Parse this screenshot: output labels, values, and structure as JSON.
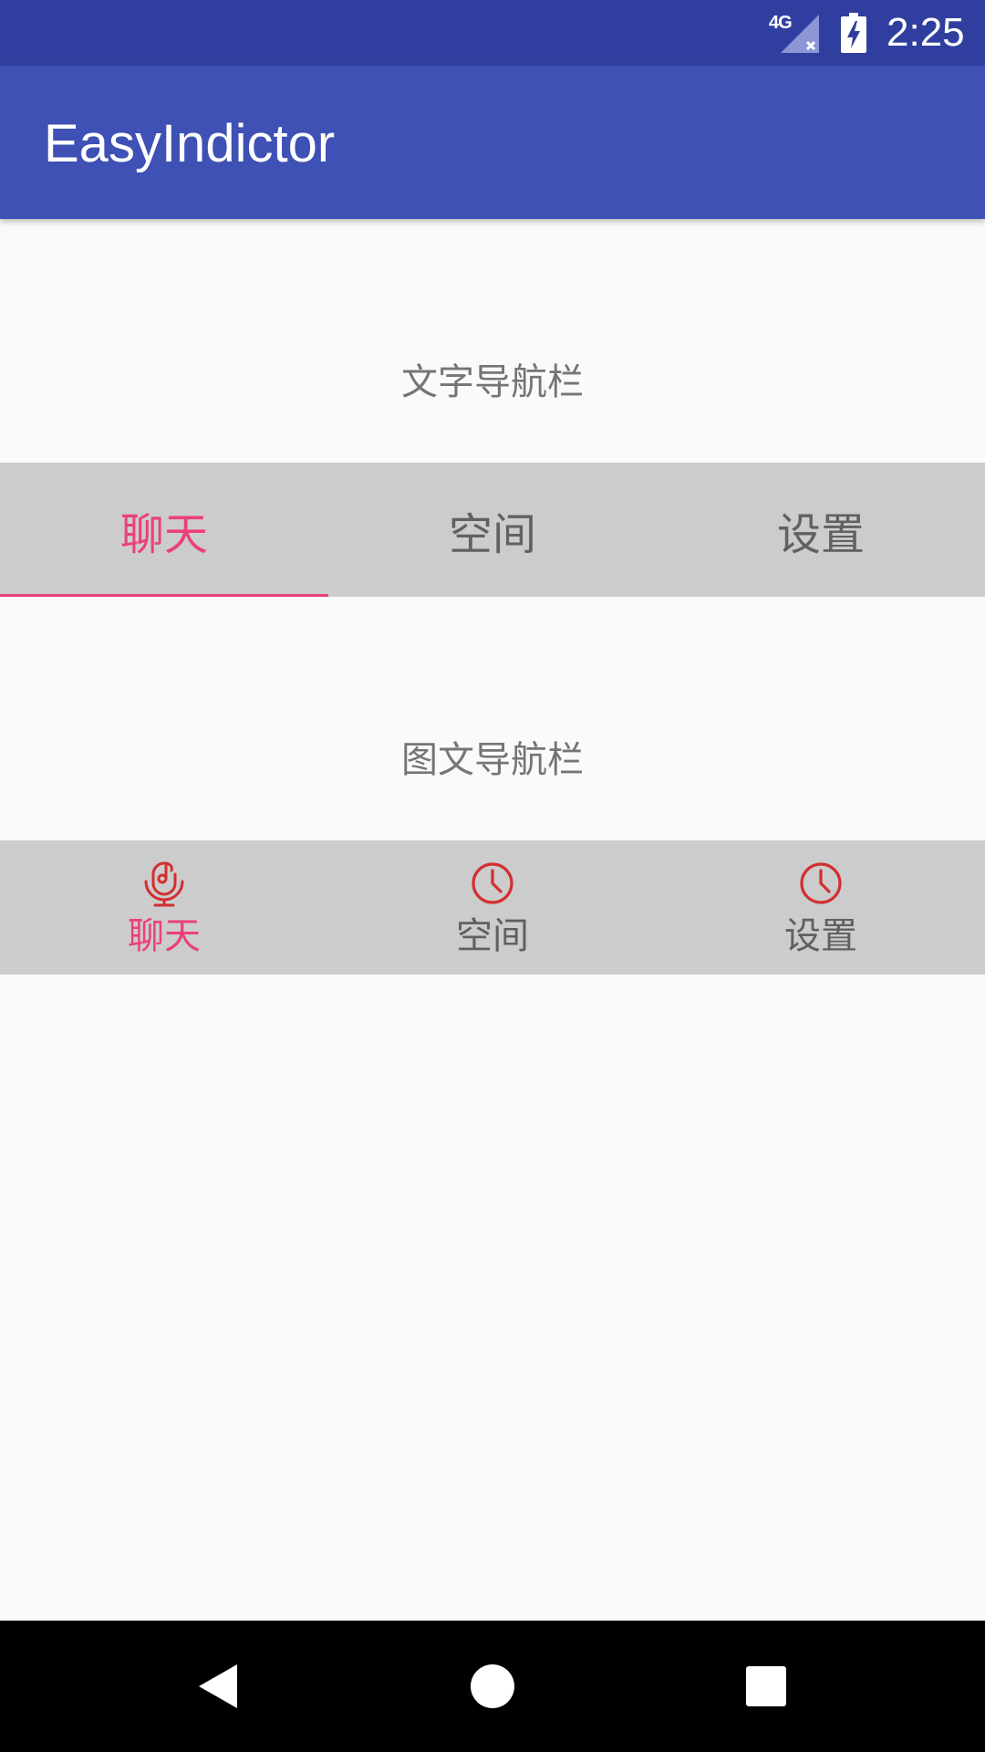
{
  "status_bar": {
    "network": "4G",
    "time": "2:25"
  },
  "app_bar": {
    "title": "EasyIndictor"
  },
  "text_nav": {
    "label": "文字导航栏",
    "tabs": [
      {
        "label": "聊天",
        "active": true
      },
      {
        "label": "空间",
        "active": false
      },
      {
        "label": "设置",
        "active": false
      }
    ]
  },
  "icon_nav": {
    "label": "图文导航栏",
    "tabs": [
      {
        "label": "聊天",
        "icon": "microphone-music-icon",
        "active": true
      },
      {
        "label": "空间",
        "icon": "clock-icon",
        "active": false
      },
      {
        "label": "设置",
        "icon": "clock-icon",
        "active": false
      }
    ]
  },
  "colors": {
    "status_bar": "#303F9F",
    "app_bar": "#3F51B5",
    "accent": "#EC407A",
    "icon": "#D32F2F",
    "indicator_bg": "#CCCCCC"
  },
  "nav_bar": {
    "buttons": [
      "back-icon",
      "home-icon",
      "recents-icon"
    ]
  }
}
